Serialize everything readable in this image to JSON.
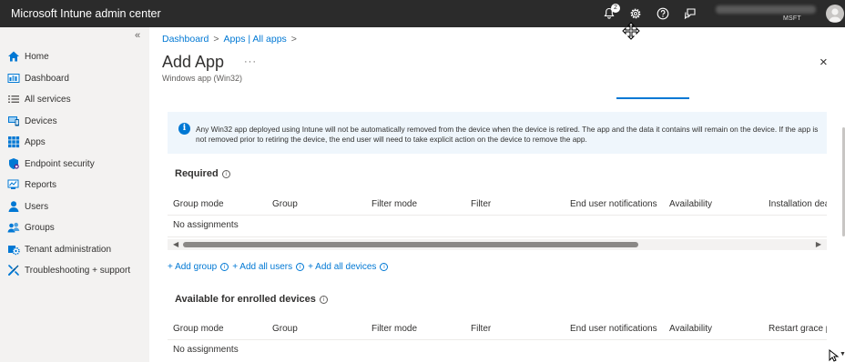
{
  "topbar": {
    "title": "Microsoft Intune admin center",
    "notification_count": "2",
    "user_org": "MSFT",
    "icons": [
      "bell-icon",
      "gear-icon",
      "help-icon",
      "feedback-icon",
      "avatar-icon"
    ]
  },
  "sidebar": {
    "collapse": "«",
    "items": [
      {
        "label": "Home",
        "icon": "home-icon"
      },
      {
        "label": "Dashboard",
        "icon": "dashboard-icon"
      },
      {
        "label": "All services",
        "icon": "list-icon"
      },
      {
        "label": "Devices",
        "icon": "devices-icon"
      },
      {
        "label": "Apps",
        "icon": "apps-grid-icon"
      },
      {
        "label": "Endpoint security",
        "icon": "shield-icon"
      },
      {
        "label": "Reports",
        "icon": "reports-icon"
      },
      {
        "label": "Users",
        "icon": "user-icon"
      },
      {
        "label": "Groups",
        "icon": "groups-icon"
      },
      {
        "label": "Tenant administration",
        "icon": "tenant-gear-icon"
      },
      {
        "label": "Troubleshooting + support",
        "icon": "wrench-icon"
      }
    ]
  },
  "breadcrumb": {
    "items": [
      "Dashboard",
      "Apps | All apps"
    ],
    "separator": ">"
  },
  "page": {
    "title": "Add App",
    "more": "···",
    "subtitle": "Windows app (Win32)",
    "close": "×"
  },
  "info_banner": {
    "text": "Any Win32 app deployed using Intune will not be automatically removed from the device when the device is retired. The app and the data it contains will remain on the device. If the app is not removed prior to retiring the device, the end user will need to take explicit action on the device to remove the app."
  },
  "required": {
    "title": "Required",
    "columns": [
      "Group mode",
      "Group",
      "Filter mode",
      "Filter",
      "End user notifications",
      "Availability",
      "Installation dea"
    ],
    "empty_text": "No assignments"
  },
  "add_links": {
    "add_group": "+ Add group",
    "add_all_users": "+ Add all users",
    "add_all_devices": "+ Add all devices"
  },
  "available": {
    "title": "Available for enrolled devices",
    "columns": [
      "Group mode",
      "Group",
      "Filter mode",
      "Filter",
      "End user notifications",
      "Availability",
      "Restart grace p"
    ],
    "empty_text": "No assignments"
  },
  "colors": {
    "accent": "#0078d4",
    "topbar": "#2b2b2b",
    "sidebar": "#f3f2f1",
    "banner": "#eff6fc"
  }
}
